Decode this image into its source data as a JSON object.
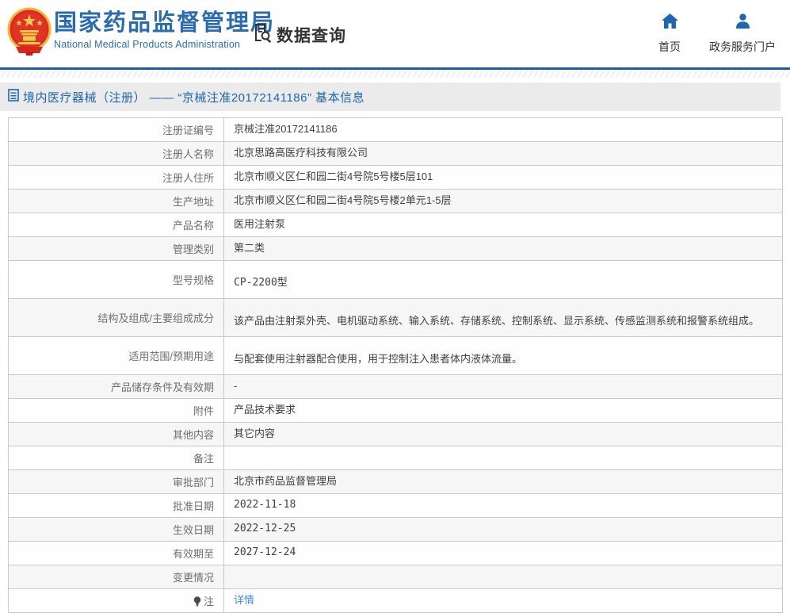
{
  "header": {
    "org_name_cn": "国家药品监督管理局",
    "org_name_en": "National Medical Products Administration",
    "section_label": "数据查询",
    "nav": [
      {
        "label": "首页"
      },
      {
        "label": "政务服务门户"
      }
    ]
  },
  "breadcrumb": {
    "title": "境内医疗器械（注册） —— “京械注准20172141186” 基本信息"
  },
  "table": {
    "rows": [
      {
        "label": "注册证编号",
        "value": "京械注准20172141186"
      },
      {
        "label": "注册人名称",
        "value": "北京思路高医疗科技有限公司"
      },
      {
        "label": "注册人住所",
        "value": "北京市顺义区仁和园二街4号院5号楼5层101"
      },
      {
        "label": "生产地址",
        "value": "北京市顺义区仁和园二街4号院5号楼2单元1-5层"
      },
      {
        "label": "产品名称",
        "value": "医用注射泵"
      },
      {
        "label": "管理类别",
        "value": "第二类"
      },
      {
        "label": "型号规格",
        "value": "CP-2200型"
      },
      {
        "label": "结构及组成/主要组成成分",
        "value": "该产品由注射泵外壳、电机驱动系统、输入系统、存储系统、控制系统、显示系统、传感监测系统和报警系统组成。"
      },
      {
        "label": "适用范围/预期用途",
        "value": "与配套使用注射器配合使用，用于控制注入患者体内液体流量。"
      },
      {
        "label": "产品储存条件及有效期",
        "value": "-"
      },
      {
        "label": "附件",
        "value": "产品技术要求"
      },
      {
        "label": "其他内容",
        "value": "其它内容"
      },
      {
        "label": "备注",
        "value": ""
      },
      {
        "label": "审批部门",
        "value": "北京市药品监督管理局"
      },
      {
        "label": "批准日期",
        "value": "2022-11-18"
      },
      {
        "label": "生效日期",
        "value": "2022-12-25"
      },
      {
        "label": "有效期至",
        "value": "2027-12-24"
      },
      {
        "label": "变更情况",
        "value": ""
      },
      {
        "label": "注",
        "value": "详情"
      }
    ]
  },
  "colors": {
    "brand_blue": "#2a6bb4",
    "title_blue": "#1f66b1",
    "divider_blue": "#1a5da3",
    "link_blue": "#3c8ce6",
    "emblem_red": "#dd2b20",
    "emblem_gold": "#f0b63a",
    "row_alt_gray": "#f6f6f6",
    "titlebar_gray": "#ebebeb",
    "border_gray": "#c9c9c9"
  }
}
